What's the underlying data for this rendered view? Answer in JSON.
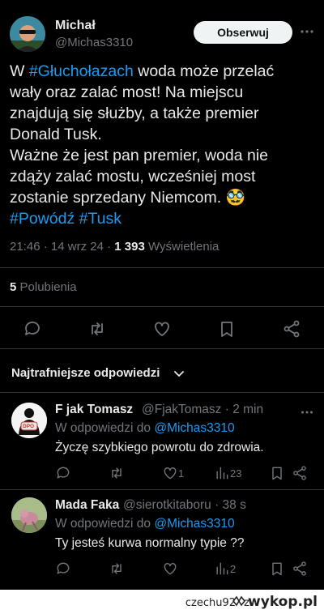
{
  "post": {
    "author_name": "Michał",
    "author_handle": "@Michas3310",
    "follow_label": "Obserwuj",
    "text_lines": [
      [
        {
          "t": "W ",
          "link": false
        },
        {
          "t": "#Głuchołazach",
          "link": true
        },
        {
          "t": " woda może przelać",
          "link": false
        }
      ],
      [
        {
          "t": "wały oraz zalać most! Na miejscu",
          "link": false
        }
      ],
      [
        {
          "t": "znajdują się służby, a także  premier",
          "link": false
        }
      ],
      [
        {
          "t": "Donald Tusk.",
          "link": false
        }
      ],
      [
        {
          "t": "Ważne że jest pan premier, woda nie",
          "link": false
        }
      ],
      [
        {
          "t": "zdąży zalać mostu, wcześniej most",
          "link": false
        }
      ],
      [
        {
          "t": "zostanie sprzedany Niemcom. 🥸",
          "link": false
        }
      ],
      [
        {
          "t": "#Powódź",
          "link": true
        },
        {
          "t": " ",
          "link": false
        },
        {
          "t": "#Tusk",
          "link": true
        }
      ]
    ],
    "time": "21:46",
    "date": "14 wrz 24",
    "views_count": "1 393",
    "views_label": "Wyświetlenia",
    "likes_count": "5",
    "likes_label": "Polubienia"
  },
  "replies_header": {
    "sort_label": "Najtrafniejsze odpowiedzi"
  },
  "replies": [
    {
      "name": "F jak Tomasz",
      "handle_time": "@FjakTomasz · 2 min",
      "reply_prefix": "W odpowiedzi do ",
      "reply_to": "@Michas3310",
      "text": "Życzę szybkiego powrotu do zdrowia.",
      "likes": "1",
      "views": "23",
      "avatar_badge": "DPO"
    },
    {
      "name": "Mada Faka",
      "handle_time": "@sierotkitaboru · 38 s",
      "reply_prefix": "W odpowiedzi do ",
      "reply_to": "@Michas3310",
      "text": "Ty jesteś kurwa normalny typie ??",
      "likes": "",
      "views": "2",
      "avatar_badge": ""
    }
  ],
  "footer": {
    "user": "czechu92",
    "separator": "z",
    "logo": "wykop.pl"
  },
  "colors": {
    "background": "#000000",
    "text": "#e7e9ea",
    "muted": "#71767b",
    "link": "#1d9bf0",
    "divider": "#2f3336"
  }
}
